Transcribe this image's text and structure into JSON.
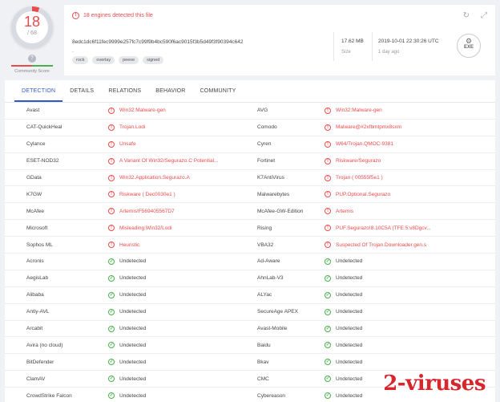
{
  "score": {
    "detected": "18",
    "total": "/ 68",
    "community_badge": "?",
    "community_label": "Community Score"
  },
  "header": {
    "alert": "18 engines detected this file",
    "hash": "8edc1dc6f11fec9999e257fc7c99f9b4bc590f6ac9015f3b5d49f3f90394c642",
    "hash_extra": "-",
    "tags": [
      "rock",
      "overlay",
      "peexe",
      "signed"
    ],
    "size_value": "17.62 MB",
    "size_label": "Size",
    "date_value": "2019-10-01 22:30:26 UTC",
    "date_label": "1 day ago",
    "file_type": "EXE"
  },
  "tabs": [
    "DETECTION",
    "DETAILS",
    "RELATIONS",
    "BEHAVIOR",
    "COMMUNITY"
  ],
  "rows": [
    {
      "e1": "Avast",
      "r1": "Win32:Malware-gen",
      "s1": "bad",
      "e2": "AVG",
      "r2": "Win32:Malware-gen",
      "s2": "bad"
    },
    {
      "e1": "CAT-QuickHeal",
      "r1": "Trojan.Lodi",
      "s1": "bad",
      "e2": "Comodo",
      "r2": "Malware@#2xfbmtpmx8sxm",
      "s2": "bad"
    },
    {
      "e1": "Cylance",
      "r1": "Unsafe",
      "s1": "bad",
      "e2": "Cyren",
      "r2": "W64/Trojan.QMOC-9381",
      "s2": "bad"
    },
    {
      "e1": "ESET-NOD32",
      "r1": "A Variant Of Win32/Segurazo.C Potential...",
      "s1": "bad",
      "e2": "Fortinet",
      "r2": "Riskware/Segurazo",
      "s2": "bad"
    },
    {
      "e1": "GData",
      "r1": "Win32.Application.Segurazo.A",
      "s1": "bad",
      "e2": "K7AntiVirus",
      "r2": "Trojan ( 00555f5e1 )",
      "s2": "bad"
    },
    {
      "e1": "K7GW",
      "r1": "Riskware ( Dec0030e1 )",
      "s1": "bad",
      "e2": "Malwarebytes",
      "r2": "PUP.Optional.Segurazo",
      "s2": "bad"
    },
    {
      "e1": "McAfee",
      "r1": "Artemis!F569405567D7",
      "s1": "bad",
      "e2": "McAfee-GW-Edition",
      "r2": "Artemis",
      "s2": "bad"
    },
    {
      "e1": "Microsoft",
      "r1": "Misleading:Win32/Lodi",
      "s1": "bad",
      "e2": "Rising",
      "r2": "PUF.Segurazo!8.10C5A (TFE:5:v8Dgcv...",
      "s2": "bad"
    },
    {
      "e1": "Sophos ML",
      "r1": "Heuristic",
      "s1": "bad",
      "e2": "VBA32",
      "r2": "Suspected Of Trojan.Downloader.gen.s",
      "s2": "bad"
    },
    {
      "e1": "Acronis",
      "r1": "Undetected",
      "s1": "ok",
      "e2": "Ad-Aware",
      "r2": "Undetected",
      "s2": "ok"
    },
    {
      "e1": "AegisLab",
      "r1": "Undetected",
      "s1": "ok",
      "e2": "AhnLab-V3",
      "r2": "Undetected",
      "s2": "ok"
    },
    {
      "e1": "Alibaba",
      "r1": "Undetected",
      "s1": "ok",
      "e2": "ALYac",
      "r2": "Undetected",
      "s2": "ok"
    },
    {
      "e1": "Antiy-AVL",
      "r1": "Undetected",
      "s1": "ok",
      "e2": "SecureAge APEX",
      "r2": "Undetected",
      "s2": "ok"
    },
    {
      "e1": "Arcabit",
      "r1": "Undetected",
      "s1": "ok",
      "e2": "Avast-Mobile",
      "r2": "Undetected",
      "s2": "ok"
    },
    {
      "e1": "Avira (no cloud)",
      "r1": "Undetected",
      "s1": "ok",
      "e2": "Baidu",
      "r2": "Undetected",
      "s2": "ok"
    },
    {
      "e1": "BitDefender",
      "r1": "Undetected",
      "s1": "ok",
      "e2": "Bkav",
      "r2": "Undetected",
      "s2": "ok"
    },
    {
      "e1": "ClamAV",
      "r1": "Undetected",
      "s1": "ok",
      "e2": "CMC",
      "r2": "Undetected",
      "s2": "ok"
    },
    {
      "e1": "CrowdStrike Falcon",
      "r1": "Undetected",
      "s1": "ok",
      "e2": "Cybereason",
      "r2": "Undetected",
      "s2": "ok"
    }
  ],
  "watermark": "2-viruses",
  "colors": {
    "alert": "#e94b4b",
    "ok": "#4bb04b",
    "accent": "#2f5bc8"
  },
  "icons": {
    "reanalyze": "refresh-icon",
    "similar": "expand-icon"
  }
}
